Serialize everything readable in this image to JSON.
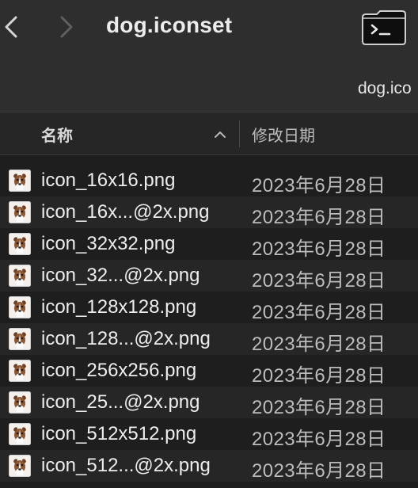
{
  "window": {
    "title": "dog.iconset",
    "icon_label": "dog.ico"
  },
  "toolbar": {
    "back_icon": "chevron-left-icon",
    "forward_icon": "chevron-right-icon",
    "file_icon": "terminal-folder-icon"
  },
  "columns": {
    "name_label": "名称",
    "date_label": "修改日期",
    "sort_icon": "chevron-up-icon"
  },
  "files": [
    {
      "name": "icon_16x16.png",
      "date": "2023年6月28日"
    },
    {
      "name": "icon_16x...@2x.png",
      "date": "2023年6月28日"
    },
    {
      "name": "icon_32x32.png",
      "date": "2023年6月28日"
    },
    {
      "name": "icon_32...@2x.png",
      "date": "2023年6月28日"
    },
    {
      "name": "icon_128x128.png",
      "date": "2023年6月28日"
    },
    {
      "name": "icon_128...@2x.png",
      "date": "2023年6月28日"
    },
    {
      "name": "icon_256x256.png",
      "date": "2023年6月28日"
    },
    {
      "name": "icon_25...@2x.png",
      "date": "2023年6月28日"
    },
    {
      "name": "icon_512x512.png",
      "date": "2023年6月28日"
    },
    {
      "name": "icon_512...@2x.png",
      "date": "2023年6月28日"
    }
  ],
  "colors": {
    "toolbar_bg": "#2e2e2e",
    "window_bg": "#1e1e1e",
    "row_alt_bg": "#262626",
    "text": "#ededed",
    "secondary_text": "#bcbcbc"
  }
}
